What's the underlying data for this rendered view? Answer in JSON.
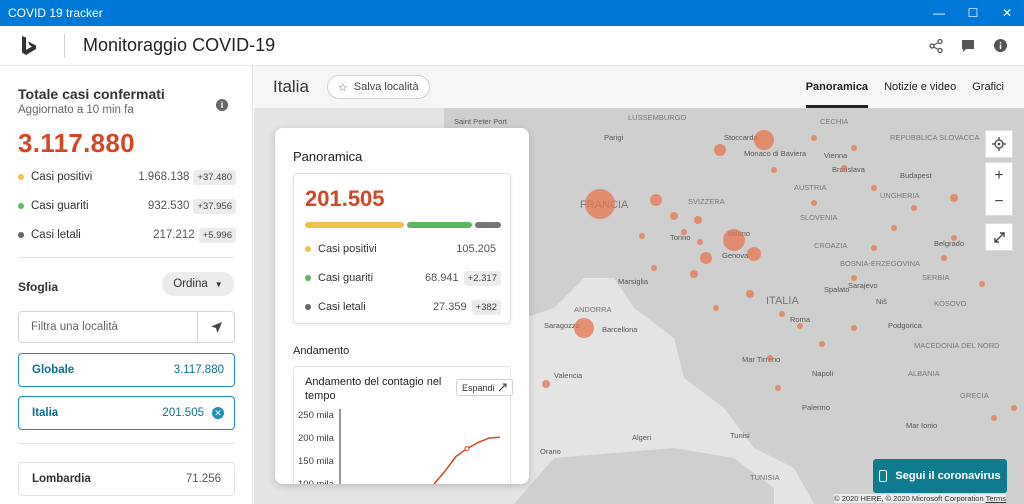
{
  "window": {
    "title": "COVID 19 tracker",
    "minimize": "—",
    "maximize": "☐",
    "close": "✕"
  },
  "header": {
    "title": "Monitoraggio COVID-19"
  },
  "summary": {
    "label": "Totale casi confermati",
    "updated": "Aggiornato a 10 min fa",
    "total": "3.117.880",
    "stats": [
      {
        "label": "Casi positivi",
        "value": "1.968.138",
        "delta": "+37.480",
        "color": "#f2c14e"
      },
      {
        "label": "Casi guariti",
        "value": "932.530",
        "delta": "+37.956",
        "color": "#5cb85c"
      },
      {
        "label": "Casi letali",
        "value": "217.212",
        "delta": "+5.996",
        "color": "#666666"
      }
    ]
  },
  "browse": {
    "label": "Sfoglia",
    "sort": "Ordina",
    "search_placeholder": "Filtra una località",
    "locations": [
      {
        "name": "Globale",
        "count": "3.117.880"
      },
      {
        "name": "Italia",
        "count": "201.505"
      },
      {
        "name": "Lombardia",
        "count": "71.256"
      }
    ]
  },
  "region": {
    "name": "Italia",
    "save": "Salva località"
  },
  "tabs": [
    "Panoramica",
    "Notizie e video",
    "Grafici"
  ],
  "overview": {
    "title": "Panoramica",
    "total": "201.505",
    "bar_fractions": [
      0.522,
      0.342,
      0.136
    ],
    "stats": [
      {
        "label": "Casi positivi",
        "value": "105.205",
        "delta": ""
      },
      {
        "label": "Casi guariti",
        "value": "68.941",
        "delta": "+2.317"
      },
      {
        "label": "Casi letali",
        "value": "27.359",
        "delta": "+382"
      }
    ],
    "trend_label": "Andamento",
    "chart_title": "Andamento del contagio nel tempo",
    "expand": "Espandi"
  },
  "chart_data": {
    "type": "line",
    "title": "Andamento del contagio nel tempo",
    "xlabel": "",
    "ylabel": "",
    "yticks": [
      "250 mila",
      "200 mila",
      "150 mila",
      "100 mila"
    ],
    "ylim": [
      100000,
      250000
    ],
    "series": [
      {
        "values": [
          100000,
          128000,
          160000,
          177000,
          190000,
          200000,
          201505
        ]
      }
    ]
  },
  "map": {
    "labels": [
      "Saint Peter Port",
      "LUSSEMBURGO",
      "Parigi",
      "CECHIA",
      "Stoccarda",
      "REPUBBLICA SLOVACCA",
      "Monaco di Baviera",
      "Vienna",
      "Bratislava",
      "Budapest",
      "FRANCIA",
      "AUSTRIA",
      "UNGHERIA",
      "SVIZZERA",
      "SLOVENIA",
      "Milano",
      "Torino",
      "CROAZIA",
      "Genova",
      "BOSNIA-ERZEGOVINA",
      "Belgrado",
      "SERBIA",
      "Marsiglia",
      "Spalato",
      "Sarajevo",
      "Niš",
      "KOSOVO",
      "ANDORRA",
      "Roma",
      "ITALIA",
      "Podgorica",
      "Saragozza",
      "Barcellona",
      "MACEDONIA DEL NORD",
      "Mar Tirreno",
      "Valencia",
      "Napoli",
      "ALBANIA",
      "Palermo",
      "GRECIA",
      "Mar Ionio",
      "Algeri",
      "Tunisi",
      "Orano",
      "TUNISIA"
    ],
    "cta": "Segui il coronavirus",
    "copyright": "© 2020 HERE, © 2020 Microsoft Corporation",
    "terms": "Terms"
  },
  "colors": {
    "accent": "#d24726",
    "titlebar": "#0078d7",
    "brand": "#1b8fb5",
    "cta": "#0e7c8c"
  }
}
